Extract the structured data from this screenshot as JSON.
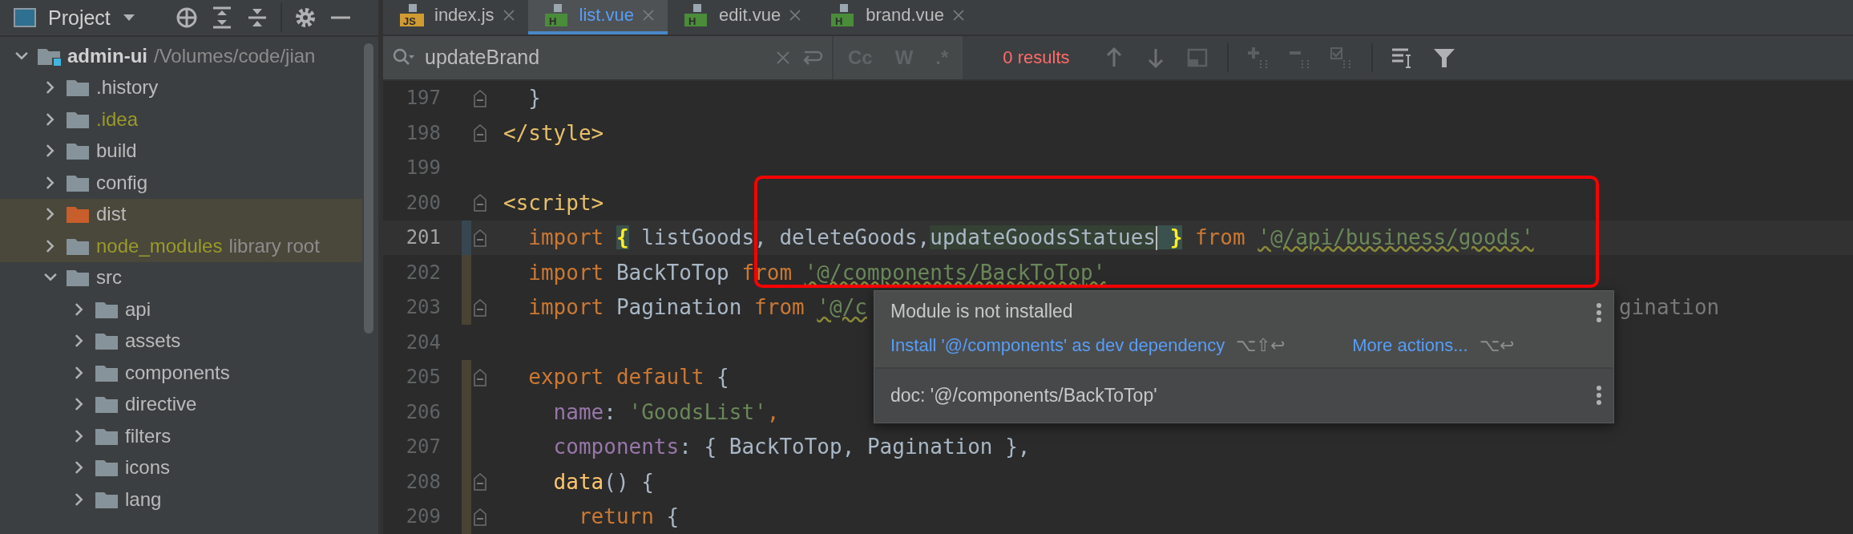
{
  "project_panel": {
    "title": "Project",
    "tree": [
      {
        "name": "admin-ui",
        "path": "/Volumes/code/jian",
        "kind": "module",
        "expanded": true,
        "children": [
          {
            "name": ".history",
            "kind": "folder",
            "expanded": false
          },
          {
            "name": ".idea",
            "kind": "ignored",
            "expanded": false
          },
          {
            "name": "build",
            "kind": "folder",
            "expanded": false
          },
          {
            "name": "config",
            "kind": "folder",
            "expanded": false
          },
          {
            "name": "dist",
            "kind": "excluded",
            "expanded": false
          },
          {
            "name": "node_modules",
            "hint": "library root",
            "kind": "library",
            "expanded": false
          },
          {
            "name": "src",
            "kind": "folder",
            "expanded": true,
            "children": [
              {
                "name": "api",
                "kind": "folder",
                "expanded": false
              },
              {
                "name": "assets",
                "kind": "folder",
                "expanded": false
              },
              {
                "name": "components",
                "kind": "folder",
                "expanded": false
              },
              {
                "name": "directive",
                "kind": "folder",
                "expanded": false
              },
              {
                "name": "filters",
                "kind": "folder",
                "expanded": false
              },
              {
                "name": "icons",
                "kind": "folder",
                "expanded": false
              },
              {
                "name": "lang",
                "kind": "folder",
                "expanded": false
              }
            ]
          }
        ]
      }
    ]
  },
  "editor_tabs": [
    {
      "label": "index.js",
      "badge": "JS",
      "kind": "js",
      "selected": false
    },
    {
      "label": "list.vue",
      "badge": "H",
      "kind": "vue",
      "selected": true
    },
    {
      "label": "edit.vue",
      "badge": "H",
      "kind": "vue",
      "selected": false
    },
    {
      "label": "brand.vue",
      "badge": "H",
      "kind": "vue",
      "selected": false
    }
  ],
  "find_bar": {
    "value": "updateBrand",
    "options": [
      {
        "label": "Cc",
        "selected": false
      },
      {
        "label": "W",
        "selected": false
      },
      {
        "label": ".*",
        "selected": false
      }
    ],
    "results": "0 results"
  },
  "code_lines": [
    {
      "number": "197",
      "fold": true,
      "current": false,
      "tokens": [
        {
          "kind": "plain",
          "text": "  }"
        }
      ]
    },
    {
      "number": "198",
      "fold": true,
      "current": false,
      "tokens": [
        {
          "kind": "tag",
          "text": "</style>"
        }
      ]
    },
    {
      "number": "199",
      "fold": false,
      "current": false
    },
    {
      "number": "200",
      "fold": true,
      "current": false,
      "tokens": [
        {
          "kind": "tag",
          "text": "<script>"
        }
      ]
    },
    {
      "number": "201",
      "fold": true,
      "current": true,
      "color": "#374752",
      "tokens": [
        {
          "kind": "keyword",
          "text": "  import "
        },
        {
          "kind": "brace",
          "text": "{"
        },
        {
          "kind": "plain",
          "text": " listGoods, deleteGoods,"
        },
        {
          "kind": "match",
          "text": "updateGoodsStatues",
          "caret": true
        },
        {
          "kind": "brace",
          "text": " }"
        },
        {
          "kind": "keyword",
          "text": " from "
        },
        {
          "kind": "string-warn",
          "text": "'@/api/business/goods'"
        }
      ]
    },
    {
      "number": "202",
      "fold": false,
      "current": false,
      "color": "#4a4334",
      "tokens": [
        {
          "kind": "keyword",
          "text": "  import"
        },
        {
          "kind": "plain",
          "text": " BackToTop "
        },
        {
          "kind": "keyword",
          "text": "from "
        },
        {
          "kind": "string-warn",
          "text": "'@/components/BackToTop'"
        }
      ]
    },
    {
      "number": "203",
      "fold": true,
      "current": false,
      "color": "#4a4334",
      "tail": "gination",
      "tokens": [
        {
          "kind": "keyword",
          "text": "  import"
        },
        {
          "kind": "plain",
          "text": " Pagination "
        },
        {
          "kind": "keyword",
          "text": "from "
        },
        {
          "kind": "string-warn",
          "text": "'@/c"
        }
      ]
    },
    {
      "number": "204",
      "fold": false,
      "current": false
    },
    {
      "number": "205",
      "fold": true,
      "current": false,
      "color": "#4a4334",
      "tokens": [
        {
          "kind": "keyword",
          "text": "  export default"
        },
        {
          "kind": "plain",
          "text": " {"
        }
      ]
    },
    {
      "number": "206",
      "fold": false,
      "current": false,
      "color": "#4a4334",
      "tokens": [
        {
          "kind": "property",
          "text": "    name"
        },
        {
          "kind": "plain",
          "text": ": "
        },
        {
          "kind": "string",
          "text": "'GoodsList'"
        },
        {
          "kind": "punct",
          "text": ","
        }
      ]
    },
    {
      "number": "207",
      "fold": false,
      "current": false,
      "color": "#4a4334",
      "tokens": [
        {
          "kind": "property",
          "text": "    components"
        },
        {
          "kind": "plain",
          "text": ": { BackToTop, Pagination },"
        }
      ]
    },
    {
      "number": "208",
      "fold": true,
      "current": false,
      "color": "#4a4334",
      "tokens": [
        {
          "kind": "function",
          "text": "    data"
        },
        {
          "kind": "plain",
          "text": "() {"
        }
      ]
    },
    {
      "number": "209",
      "fold": true,
      "current": false,
      "color": "#4a4334",
      "tokens": [
        {
          "kind": "keyword",
          "text": "      return"
        },
        {
          "kind": "plain",
          "text": " {"
        }
      ]
    }
  ],
  "popup": {
    "title": "Module is not installed",
    "actions": [
      {
        "label": "Install '@/components' as dev dependency",
        "shortcut": "⌥⇧↩"
      },
      {
        "label": "More actions...",
        "shortcut": "⌥↩"
      }
    ],
    "doc": "doc: '@/components/BackToTop'"
  }
}
